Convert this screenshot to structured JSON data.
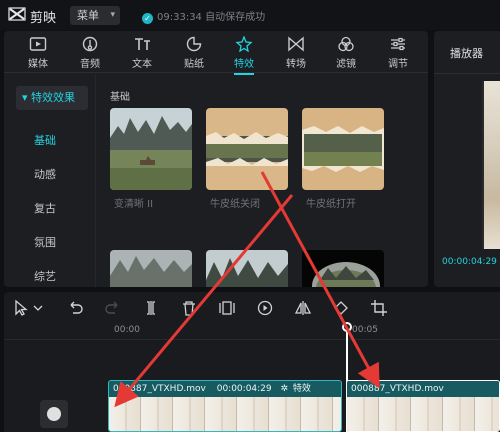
{
  "app": {
    "name": "剪映",
    "menu_label": "菜单",
    "save_status": "09:33:34 自动保存成功"
  },
  "toolbar": {
    "tabs": [
      {
        "label": "媒体",
        "icon": "media-icon"
      },
      {
        "label": "音频",
        "icon": "audio-icon"
      },
      {
        "label": "文本",
        "icon": "text-icon"
      },
      {
        "label": "贴纸",
        "icon": "sticker-icon"
      },
      {
        "label": "特效",
        "icon": "effects-icon",
        "active": true
      },
      {
        "label": "转场",
        "icon": "transition-icon"
      },
      {
        "label": "滤镜",
        "icon": "filter-icon"
      },
      {
        "label": "调节",
        "icon": "adjust-icon"
      }
    ]
  },
  "sidebar": {
    "header": "特效效果",
    "items": [
      "基础",
      "动感",
      "复古",
      "氛围",
      "综艺"
    ],
    "active_index": 0
  },
  "effects": {
    "section_title": "基础",
    "cards": [
      {
        "label": "变清晰 II"
      },
      {
        "label": "牛皮纸关闭"
      },
      {
        "label": "牛皮纸打开"
      },
      {
        "label": ""
      },
      {
        "label": ""
      },
      {
        "label": ""
      }
    ]
  },
  "player": {
    "title": "播放器",
    "time": "00:00:04:29"
  },
  "timeline": {
    "ruler": [
      "00:00",
      "00:05"
    ],
    "clips": [
      {
        "name": "000887_VTXHD.mov",
        "duration": "00:00:04:29",
        "effect": "特效"
      },
      {
        "name": "000887_VTXHD.mov"
      }
    ]
  },
  "colors": {
    "accent": "#22d3e0",
    "annotation_arrow": "#e53935",
    "clip_border": "#2fb9c3"
  }
}
